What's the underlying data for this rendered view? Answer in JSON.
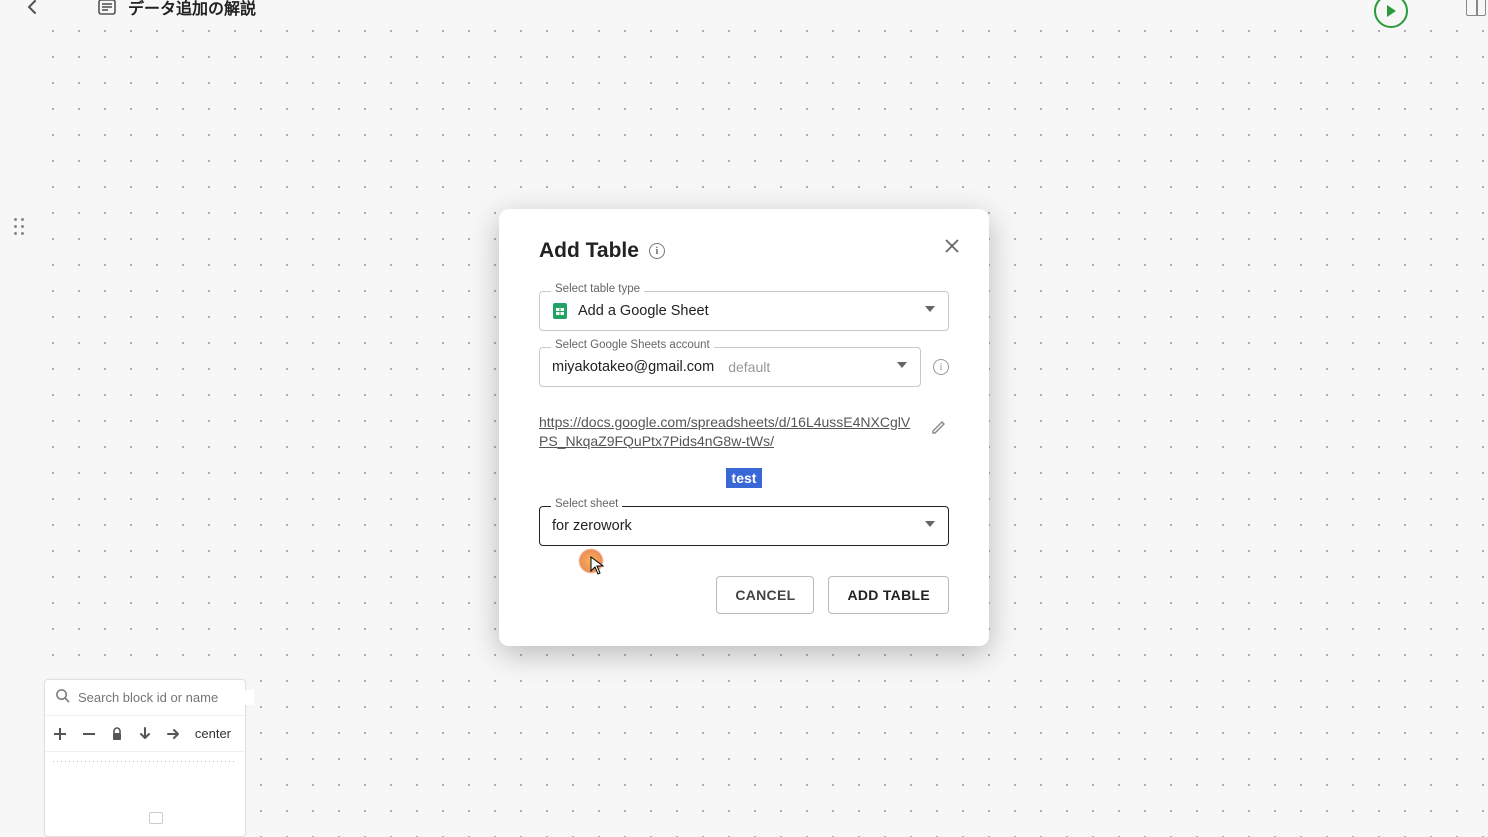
{
  "header": {
    "title": "データ追加の解説"
  },
  "bottomToolbar": {
    "searchPlaceholder": "Search block id or name",
    "centerLabel": "center"
  },
  "modal": {
    "title": "Add Table",
    "fields": {
      "tableType": {
        "label": "Select table type",
        "value": "Add a Google Sheet"
      },
      "account": {
        "label": "Select Google Sheets account",
        "value": "miyakotakeo@gmail.com",
        "defaultLabel": "default"
      },
      "url": "https://docs.google.com/spreadsheets/d/16L4ussE4NXCglVPS_NkqaZ9FQuPtx7Pids4nG8w-tWs/",
      "sheet": {
        "label": "Select sheet",
        "value": "for zerowork"
      }
    },
    "badge": "test",
    "buttons": {
      "cancel": "CANCEL",
      "add": "ADD TABLE"
    }
  }
}
